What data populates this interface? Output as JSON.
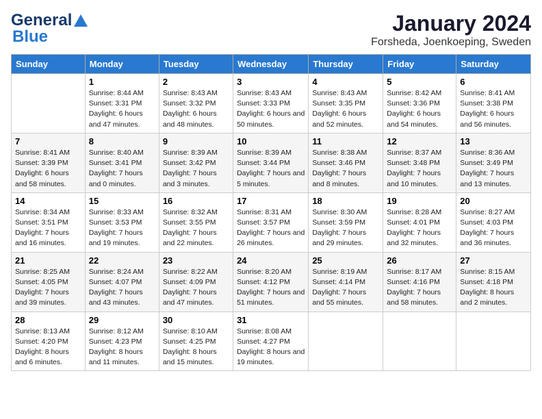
{
  "logo": {
    "line1": "General",
    "line2": "Blue"
  },
  "title": "January 2024",
  "subtitle": "Forsheda, Joenkoeping, Sweden",
  "headers": [
    "Sunday",
    "Monday",
    "Tuesday",
    "Wednesday",
    "Thursday",
    "Friday",
    "Saturday"
  ],
  "weeks": [
    [
      {
        "day": "",
        "sunrise": "",
        "sunset": "",
        "daylight": ""
      },
      {
        "day": "1",
        "sunrise": "Sunrise: 8:44 AM",
        "sunset": "Sunset: 3:31 PM",
        "daylight": "Daylight: 6 hours and 47 minutes."
      },
      {
        "day": "2",
        "sunrise": "Sunrise: 8:43 AM",
        "sunset": "Sunset: 3:32 PM",
        "daylight": "Daylight: 6 hours and 48 minutes."
      },
      {
        "day": "3",
        "sunrise": "Sunrise: 8:43 AM",
        "sunset": "Sunset: 3:33 PM",
        "daylight": "Daylight: 6 hours and 50 minutes."
      },
      {
        "day": "4",
        "sunrise": "Sunrise: 8:43 AM",
        "sunset": "Sunset: 3:35 PM",
        "daylight": "Daylight: 6 hours and 52 minutes."
      },
      {
        "day": "5",
        "sunrise": "Sunrise: 8:42 AM",
        "sunset": "Sunset: 3:36 PM",
        "daylight": "Daylight: 6 hours and 54 minutes."
      },
      {
        "day": "6",
        "sunrise": "Sunrise: 8:41 AM",
        "sunset": "Sunset: 3:38 PM",
        "daylight": "Daylight: 6 hours and 56 minutes."
      }
    ],
    [
      {
        "day": "7",
        "sunrise": "Sunrise: 8:41 AM",
        "sunset": "Sunset: 3:39 PM",
        "daylight": "Daylight: 6 hours and 58 minutes."
      },
      {
        "day": "8",
        "sunrise": "Sunrise: 8:40 AM",
        "sunset": "Sunset: 3:41 PM",
        "daylight": "Daylight: 7 hours and 0 minutes."
      },
      {
        "day": "9",
        "sunrise": "Sunrise: 8:39 AM",
        "sunset": "Sunset: 3:42 PM",
        "daylight": "Daylight: 7 hours and 3 minutes."
      },
      {
        "day": "10",
        "sunrise": "Sunrise: 8:39 AM",
        "sunset": "Sunset: 3:44 PM",
        "daylight": "Daylight: 7 hours and 5 minutes."
      },
      {
        "day": "11",
        "sunrise": "Sunrise: 8:38 AM",
        "sunset": "Sunset: 3:46 PM",
        "daylight": "Daylight: 7 hours and 8 minutes."
      },
      {
        "day": "12",
        "sunrise": "Sunrise: 8:37 AM",
        "sunset": "Sunset: 3:48 PM",
        "daylight": "Daylight: 7 hours and 10 minutes."
      },
      {
        "day": "13",
        "sunrise": "Sunrise: 8:36 AM",
        "sunset": "Sunset: 3:49 PM",
        "daylight": "Daylight: 7 hours and 13 minutes."
      }
    ],
    [
      {
        "day": "14",
        "sunrise": "Sunrise: 8:34 AM",
        "sunset": "Sunset: 3:51 PM",
        "daylight": "Daylight: 7 hours and 16 minutes."
      },
      {
        "day": "15",
        "sunrise": "Sunrise: 8:33 AM",
        "sunset": "Sunset: 3:53 PM",
        "daylight": "Daylight: 7 hours and 19 minutes."
      },
      {
        "day": "16",
        "sunrise": "Sunrise: 8:32 AM",
        "sunset": "Sunset: 3:55 PM",
        "daylight": "Daylight: 7 hours and 22 minutes."
      },
      {
        "day": "17",
        "sunrise": "Sunrise: 8:31 AM",
        "sunset": "Sunset: 3:57 PM",
        "daylight": "Daylight: 7 hours and 26 minutes."
      },
      {
        "day": "18",
        "sunrise": "Sunrise: 8:30 AM",
        "sunset": "Sunset: 3:59 PM",
        "daylight": "Daylight: 7 hours and 29 minutes."
      },
      {
        "day": "19",
        "sunrise": "Sunrise: 8:28 AM",
        "sunset": "Sunset: 4:01 PM",
        "daylight": "Daylight: 7 hours and 32 minutes."
      },
      {
        "day": "20",
        "sunrise": "Sunrise: 8:27 AM",
        "sunset": "Sunset: 4:03 PM",
        "daylight": "Daylight: 7 hours and 36 minutes."
      }
    ],
    [
      {
        "day": "21",
        "sunrise": "Sunrise: 8:25 AM",
        "sunset": "Sunset: 4:05 PM",
        "daylight": "Daylight: 7 hours and 39 minutes."
      },
      {
        "day": "22",
        "sunrise": "Sunrise: 8:24 AM",
        "sunset": "Sunset: 4:07 PM",
        "daylight": "Daylight: 7 hours and 43 minutes."
      },
      {
        "day": "23",
        "sunrise": "Sunrise: 8:22 AM",
        "sunset": "Sunset: 4:09 PM",
        "daylight": "Daylight: 7 hours and 47 minutes."
      },
      {
        "day": "24",
        "sunrise": "Sunrise: 8:20 AM",
        "sunset": "Sunset: 4:12 PM",
        "daylight": "Daylight: 7 hours and 51 minutes."
      },
      {
        "day": "25",
        "sunrise": "Sunrise: 8:19 AM",
        "sunset": "Sunset: 4:14 PM",
        "daylight": "Daylight: 7 hours and 55 minutes."
      },
      {
        "day": "26",
        "sunrise": "Sunrise: 8:17 AM",
        "sunset": "Sunset: 4:16 PM",
        "daylight": "Daylight: 7 hours and 58 minutes."
      },
      {
        "day": "27",
        "sunrise": "Sunrise: 8:15 AM",
        "sunset": "Sunset: 4:18 PM",
        "daylight": "Daylight: 8 hours and 2 minutes."
      }
    ],
    [
      {
        "day": "28",
        "sunrise": "Sunrise: 8:13 AM",
        "sunset": "Sunset: 4:20 PM",
        "daylight": "Daylight: 8 hours and 6 minutes."
      },
      {
        "day": "29",
        "sunrise": "Sunrise: 8:12 AM",
        "sunset": "Sunset: 4:23 PM",
        "daylight": "Daylight: 8 hours and 11 minutes."
      },
      {
        "day": "30",
        "sunrise": "Sunrise: 8:10 AM",
        "sunset": "Sunset: 4:25 PM",
        "daylight": "Daylight: 8 hours and 15 minutes."
      },
      {
        "day": "31",
        "sunrise": "Sunrise: 8:08 AM",
        "sunset": "Sunset: 4:27 PM",
        "daylight": "Daylight: 8 hours and 19 minutes."
      },
      {
        "day": "",
        "sunrise": "",
        "sunset": "",
        "daylight": ""
      },
      {
        "day": "",
        "sunrise": "",
        "sunset": "",
        "daylight": ""
      },
      {
        "day": "",
        "sunrise": "",
        "sunset": "",
        "daylight": ""
      }
    ]
  ]
}
